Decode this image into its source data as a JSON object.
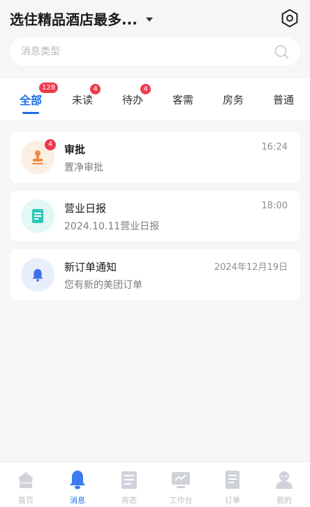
{
  "header": {
    "hotel_name": "选住精品酒店最多...",
    "settings_icon": "hexagon-settings-icon"
  },
  "search": {
    "placeholder": "消息类型",
    "icon": "search-icon"
  },
  "tabs": [
    {
      "label": "全部",
      "badge": "128",
      "active": true
    },
    {
      "label": "未读",
      "badge": "4"
    },
    {
      "label": "待办",
      "badge": "4"
    },
    {
      "label": "客需"
    },
    {
      "label": "房务"
    },
    {
      "label": "普通"
    }
  ],
  "messages": [
    {
      "title": "审批",
      "subtitle": "置净审批",
      "time": "16:24",
      "badge": "4",
      "icon": "stamp-icon",
      "icon_color": "#f08a3c",
      "icon_bg": "#fdeee3"
    },
    {
      "title": "营业日报",
      "subtitle": "2024.10.11营业日报",
      "time": "18:00",
      "icon": "report-icon",
      "icon_color": "#2cc7b8",
      "icon_bg": "#e2f8f6"
    },
    {
      "title": "新订单通知",
      "subtitle": "您有新的美团订单",
      "time": "2024年12月19日",
      "icon": "bell-icon",
      "icon_color": "#3b6fe6",
      "icon_bg": "#e8eefc"
    }
  ],
  "bottom_nav": [
    {
      "label": "首页",
      "icon": "home-icon"
    },
    {
      "label": "消息",
      "icon": "bell-icon",
      "active": true
    },
    {
      "label": "房态",
      "icon": "room-status-icon"
    },
    {
      "label": "工作台",
      "icon": "workbench-icon"
    },
    {
      "label": "订单",
      "icon": "order-icon"
    },
    {
      "label": "我的",
      "icon": "profile-icon"
    }
  ],
  "colors": {
    "accent": "#1e6fe6",
    "badge": "#ef3a4d",
    "background": "#f5f6f8"
  }
}
